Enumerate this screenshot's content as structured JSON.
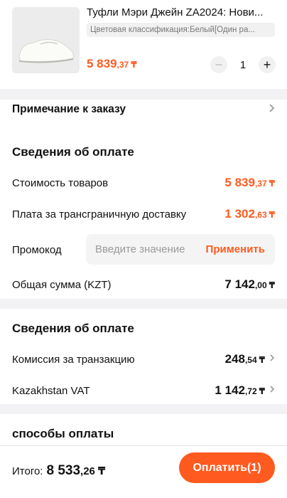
{
  "product": {
    "title": "Туфли Мэри Джейн ZA2024: Нови...",
    "variant": "Цветовая классификация:Белый[Один ра...",
    "price": {
      "int": "5 839",
      "dec": ",37",
      "cur": "₸"
    },
    "quantity": "1",
    "minus": "−",
    "plus": "+"
  },
  "order_note": {
    "label": "Примечание к заказу"
  },
  "payment_info": {
    "title": "Сведения об оплате",
    "goods_label": "Стоимость товаров",
    "goods_price": {
      "int": "5 839",
      "dec": ",37",
      "cur": "₸"
    },
    "delivery_label": "Плата за трансграничную доставку",
    "delivery_price": {
      "int": "1 302",
      "dec": ",63",
      "cur": "₸"
    },
    "promo_label": "Промокод",
    "promo_placeholder": "Введите значение",
    "promo_value": "",
    "promo_apply": "Применить",
    "total_label": "Общая сумма (KZT)",
    "total_price": {
      "int": "7 142",
      "dec": ",00",
      "cur": "₸"
    }
  },
  "payment_info2": {
    "title": "Сведения об оплате",
    "fee_label": "Комиссия за транзакцию",
    "fee_price": {
      "int": "248",
      "dec": ",54",
      "cur": "₸"
    },
    "vat_label": "Kazakhstan VAT",
    "vat_price": {
      "int": "1 142",
      "dec": ",72",
      "cur": "₸"
    }
  },
  "payment_methods": {
    "title": "способы оплаты"
  },
  "bottom": {
    "total_label": "Итого:",
    "total_price": {
      "int": "8 533",
      "dec": ",26",
      "cur": "₸"
    },
    "pay_button": "Оплатить(1)"
  },
  "colors": {
    "accent": "#ff5a1f",
    "background": "#f2f2f4"
  },
  "icons": {
    "chevron": "chevron-right-icon"
  }
}
